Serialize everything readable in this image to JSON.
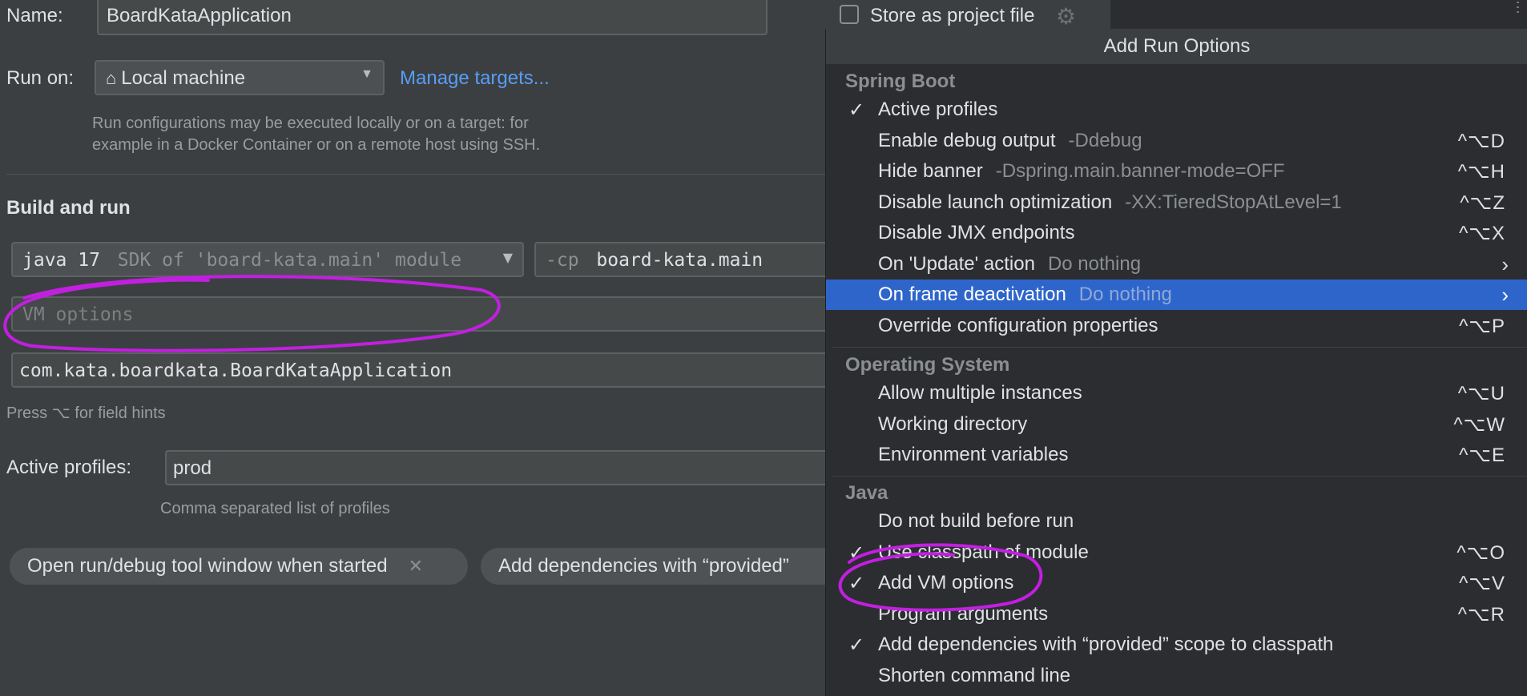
{
  "form": {
    "name_label": "Name:",
    "name_value": "BoardKataApplication",
    "store_label": "Store as project file",
    "runon_label": "Run on:",
    "runon_value": "Local machine",
    "manage_targets": "Manage targets...",
    "runon_hint_1": "Run configurations may be executed locally or on a target: for",
    "runon_hint_2": "example in a Docker Container or on a remote host using SSH.",
    "build_header": "Build and run",
    "sdk_java": "java 17",
    "sdk_detail": "SDK of 'board-kata.main' module",
    "cp_flag": "-cp",
    "cp_value": "board-kata.main",
    "vm_placeholder": "VM options",
    "main_class": "com.kata.boardkata.BoardKataApplication",
    "field_hint": "Press ⌥ for field hints",
    "profiles_label": "Active profiles:",
    "profiles_value": "prod",
    "profiles_hint": "Comma separated list of profiles",
    "chip_1": "Open run/debug tool window when started",
    "chip_2": "Add dependencies with “provided”"
  },
  "popup": {
    "title": "Add Run Options",
    "sections": {
      "spring": "Spring Boot",
      "os": "Operating System",
      "java": "Java"
    },
    "items": [
      {
        "label": "Active profiles",
        "sub": "",
        "shortcut": "",
        "check": "✓"
      },
      {
        "label": "Enable debug output",
        "sub": "-Ddebug",
        "shortcut": "^⌥D",
        "check": ""
      },
      {
        "label": "Hide banner",
        "sub": "-Dspring.main.banner-mode=OFF",
        "shortcut": "^⌥H",
        "check": ""
      },
      {
        "label": "Disable launch optimization",
        "sub": "-XX:TieredStopAtLevel=1",
        "shortcut": "^⌥Z",
        "check": ""
      },
      {
        "label": "Disable JMX endpoints",
        "sub": "",
        "shortcut": "^⌥X",
        "check": ""
      },
      {
        "label": "On 'Update' action",
        "sub": "Do nothing",
        "shortcut": "",
        "check": "",
        "arrow": "›"
      },
      {
        "label": "On frame deactivation",
        "sub": "Do nothing",
        "shortcut": "",
        "check": "",
        "arrow": "›"
      },
      {
        "label": "Override configuration properties",
        "sub": "",
        "shortcut": "^⌥P",
        "check": ""
      },
      {
        "label": "Allow multiple instances",
        "sub": "",
        "shortcut": "^⌥U",
        "check": ""
      },
      {
        "label": "Working directory",
        "sub": "",
        "shortcut": "^⌥W",
        "check": ""
      },
      {
        "label": "Environment variables",
        "sub": "",
        "shortcut": "^⌥E",
        "check": ""
      },
      {
        "label": "Do not build before run",
        "sub": "",
        "shortcut": "",
        "check": ""
      },
      {
        "label": "Use classpath of module",
        "sub": "",
        "shortcut": "^⌥O",
        "check": "✓"
      },
      {
        "label": "Add VM options",
        "sub": "",
        "shortcut": "^⌥V",
        "check": "✓"
      },
      {
        "label": "Program arguments",
        "sub": "",
        "shortcut": "^⌥R",
        "check": ""
      },
      {
        "label": "Add dependencies with “provided” scope to classpath",
        "sub": "",
        "shortcut": "",
        "check": "✓"
      },
      {
        "label": "Shorten command line",
        "sub": "",
        "shortcut": "",
        "check": ""
      }
    ]
  },
  "colors": {
    "annotation": "#c21fe0",
    "selection": "#2e65ca",
    "link": "#589df6"
  }
}
